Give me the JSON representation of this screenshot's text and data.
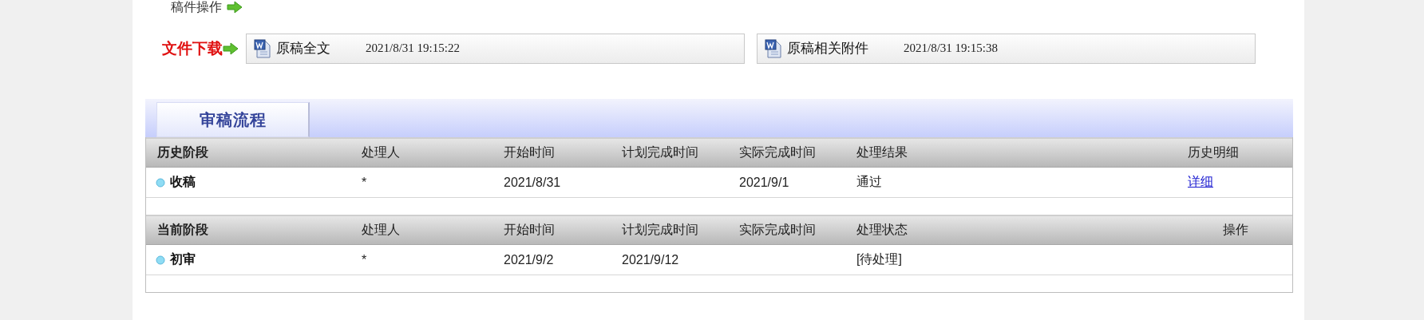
{
  "manuscript_actions": {
    "label": "稿件操作"
  },
  "downloads": {
    "label": "文件下载",
    "files": [
      {
        "name": "原稿全文",
        "time": "2021/8/31 19:15:22"
      },
      {
        "name": "原稿相关附件",
        "time": "2021/8/31 19:15:38"
      }
    ]
  },
  "workflow": {
    "tabs": [
      {
        "label": "审稿流程",
        "selected": true
      }
    ],
    "tables": [
      {
        "columns": [
          "历史阶段",
          "处理人",
          "开始时间",
          "计划完成时间",
          "实际完成时间",
          "处理结果",
          "历史明细"
        ],
        "rows": [
          {
            "cells": [
              {
                "kind": "stage",
                "text": "收稿"
              },
              {
                "kind": "text",
                "text": "*"
              },
              {
                "kind": "text",
                "text": "2021/8/31"
              },
              null,
              {
                "kind": "text",
                "text": "2021/9/1"
              },
              {
                "kind": "text",
                "text": "通过"
              },
              {
                "kind": "link",
                "text": "详细"
              }
            ]
          }
        ]
      },
      {
        "columns": [
          "当前阶段",
          "处理人",
          "开始时间",
          "计划完成时间",
          "实际完成时间",
          "处理状态",
          "操作"
        ],
        "rows": [
          {
            "cells": [
              {
                "kind": "stage",
                "text": "初审"
              },
              {
                "kind": "text",
                "text": "*"
              },
              {
                "kind": "text",
                "text": "2021/9/2"
              },
              {
                "kind": "text",
                "text": "2021/9/12"
              },
              null,
              {
                "kind": "text",
                "text": "[待处理]"
              },
              null
            ]
          }
        ]
      }
    ]
  }
}
